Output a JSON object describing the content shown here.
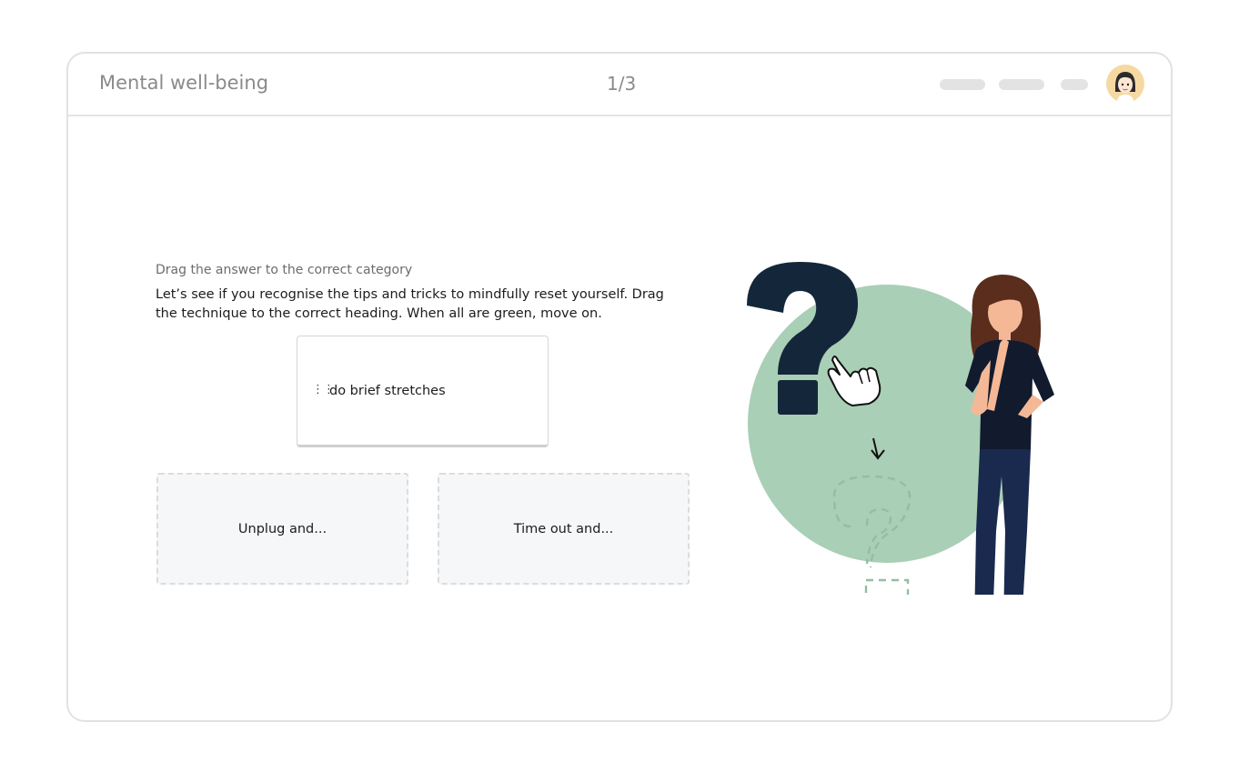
{
  "header": {
    "title": "Mental well-being",
    "progress": "1/3",
    "avatar_icon": "user-avatar-icon"
  },
  "question": {
    "label": "Drag the answer to the correct category",
    "instructions": "Let’s see if you recognise the tips and tricks to mindfully reset yourself. Drag the technique to the correct heading. When all are green, move on."
  },
  "drag_item": {
    "handle_icon": "drag-handle-icon",
    "text": "do brief stretches"
  },
  "drop_zones": [
    {
      "label": "Unplug and..."
    },
    {
      "label": "Time out and..."
    }
  ],
  "illustration": {
    "icons": [
      "question-mark-icon",
      "pointing-hand-icon",
      "arrow-down-icon",
      "dashed-question-mark-icon",
      "thinking-woman-figure"
    ]
  },
  "colors": {
    "circle": "#a9cfb6",
    "question_mark": "#14273a",
    "avatar_bg": "#f6d9a2",
    "border": "#e2e2e2"
  }
}
